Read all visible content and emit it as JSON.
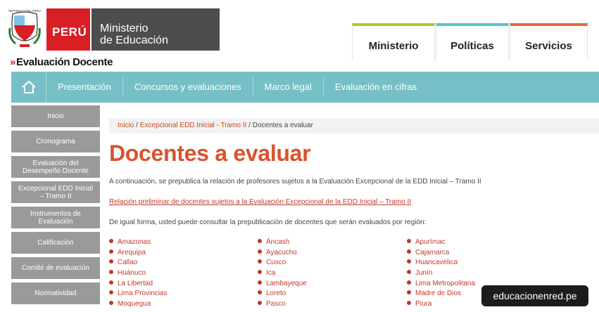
{
  "header": {
    "shield_text": "REPÚBLICA DEL PERÚ",
    "brand": "PERÚ",
    "ministry_line1": "Ministerio",
    "ministry_line2": "de Educación",
    "site_title": "Evaluación Docente",
    "top_tabs": [
      {
        "label": "Ministerio"
      },
      {
        "label": "Políticas"
      },
      {
        "label": "Servicios"
      }
    ]
  },
  "nav": {
    "home_icon": "home-icon",
    "items": [
      {
        "label": "Presentación"
      },
      {
        "label": "Concursos y evaluaciones"
      },
      {
        "label": "Marco legal"
      },
      {
        "label": "Evaluación en cifras"
      }
    ]
  },
  "sidebar": {
    "items": [
      {
        "label": "Inicio"
      },
      {
        "label": "Cronograma"
      },
      {
        "label": "Evaluación del Desempeño Docente"
      },
      {
        "label": "Excepcional EDD Inicial – Tramo II"
      },
      {
        "label": "Instrumentos de Evaluación"
      },
      {
        "label": "Calificación"
      },
      {
        "label": "Comité de evaluación"
      },
      {
        "label": "Normatividad"
      }
    ]
  },
  "breadcrumb": {
    "home": "Inicio",
    "sep1": " / ",
    "section": "Excepcional EDD Inicial - Tramo II",
    "sep2": " / ",
    "current": "Docentes a evaluar"
  },
  "main": {
    "title": "Docentes a evaluar",
    "intro": "A continuación, se prepublica la relación de profesores sujetos a la Evaluación Excepcional de la EDD Inicial – Tramo II",
    "link": "Relación preliminar de docentes sujetos a la Evaluación Excepcional de la EDD Inicial – Tramo II",
    "region_intro": "De igual forma, usted puede consultar la prepublicación de docentes que serán evaluados por región:",
    "regions": {
      "col1": [
        "Amazonas",
        "Arequipa",
        "Callao",
        "Huánuco",
        "La Libertad",
        "Lima Provincias",
        "Moquegua"
      ],
      "col2": [
        "Áncash",
        "Ayacucho",
        "Cusco",
        "Ica",
        "Lambayeque",
        "Loreto",
        "Pasco"
      ],
      "col3": [
        "Apurímac",
        "Cajamarca",
        "Huancavelica",
        "Junín",
        "Lima Metropolitana",
        "Madre de Dios",
        "Piura"
      ]
    }
  },
  "watermark": {
    "badge": "educacionenred.pe"
  },
  "colors": {
    "brand_red": "#d81f26",
    "ministry_gray": "#4d4d4f",
    "nav_teal": "#76bfc7",
    "title_orange": "#d9532b",
    "link_red": "#c0392b",
    "sidebar_gray": "#9a9a9a",
    "tab_green": "#b7c425",
    "tab_cyan": "#59c1d1",
    "tab_orange": "#e36a42"
  }
}
